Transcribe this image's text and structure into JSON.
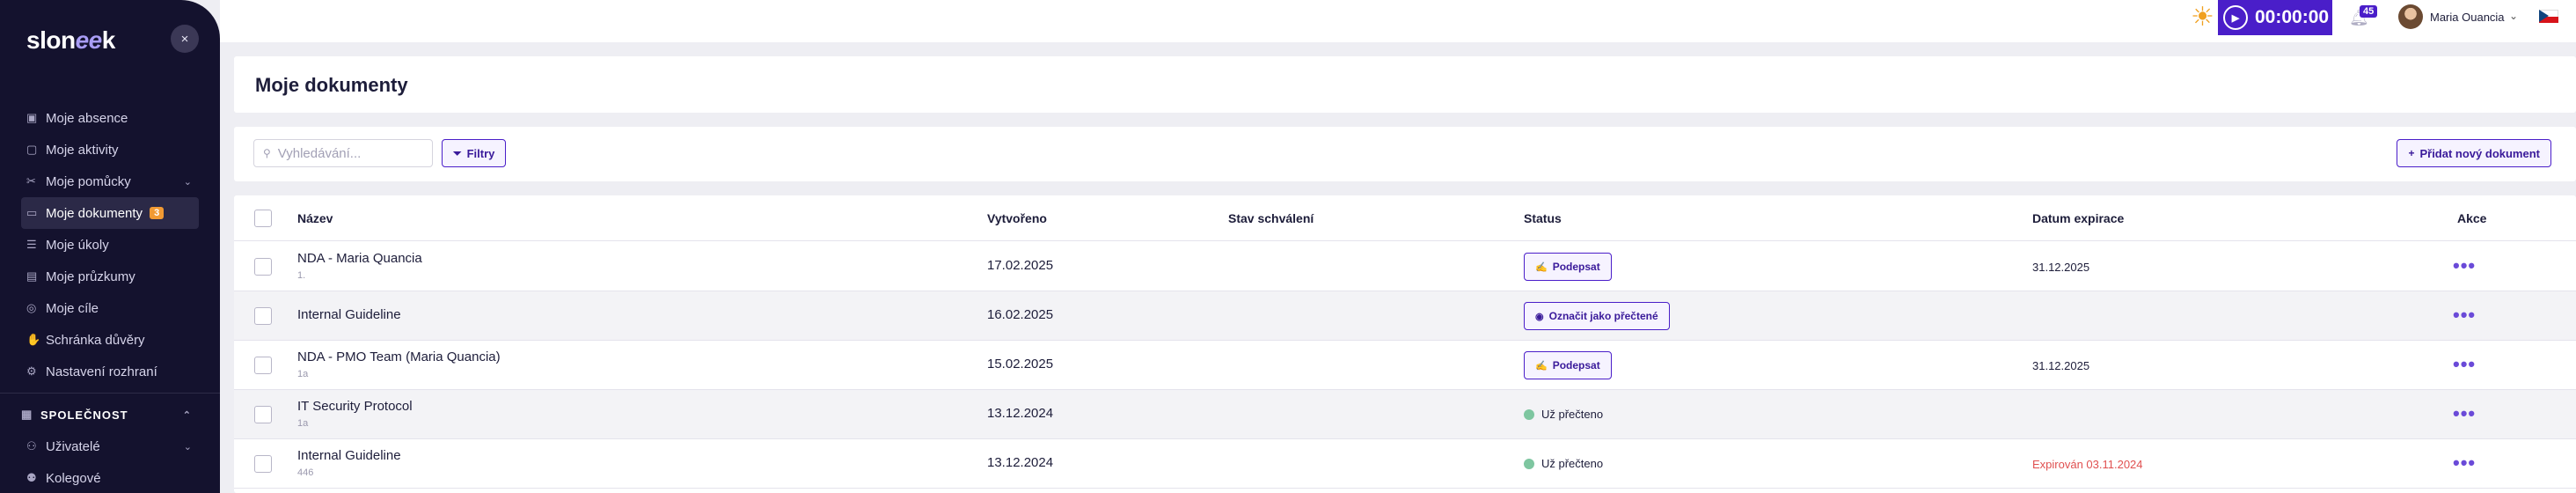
{
  "app": {
    "logo_text": "slon",
    "logo_accent": "ee",
    "logo_tail": "k",
    "close_symbol": "×"
  },
  "sidebar": {
    "items": [
      {
        "label": "Moje absence",
        "icon": "calendar-icon",
        "glyph": "▣"
      },
      {
        "label": "Moje aktivity",
        "icon": "book-icon",
        "glyph": "▢"
      },
      {
        "label": "Moje pomůcky",
        "icon": "tools-icon",
        "glyph": "✂",
        "chevron": "⌄"
      },
      {
        "label": "Moje dokumenty",
        "icon": "folder-icon",
        "glyph": "▭",
        "badge": "3",
        "active": true
      },
      {
        "label": "Moje úkoly",
        "icon": "list-icon",
        "glyph": "☰"
      },
      {
        "label": "Moje průzkumy",
        "icon": "survey-icon",
        "glyph": "▤"
      },
      {
        "label": "Moje cíle",
        "icon": "target-icon",
        "glyph": "◎"
      },
      {
        "label": "Schránka důvěry",
        "icon": "hand-icon",
        "glyph": "✋"
      },
      {
        "label": "Nastavení rozhraní",
        "icon": "gear-icon",
        "glyph": "⚙"
      }
    ],
    "section": {
      "label": "SPOLEČNOST",
      "icon": "building-icon",
      "glyph": "▦",
      "chevron": "⌃"
    },
    "section_items": [
      {
        "label": "Uživatelé",
        "icon": "users-icon",
        "glyph": "⚇",
        "chevron": "⌄"
      },
      {
        "label": "Kolegové",
        "icon": "colleagues-icon",
        "glyph": "⚉"
      }
    ]
  },
  "topbar": {
    "timer": "00:00:00",
    "notification_count": "45",
    "user_name": "Maria Ouancia",
    "language_flag": "czech-flag"
  },
  "page": {
    "title": "Moje dokumenty"
  },
  "filters": {
    "search_placeholder": "Vyhledávání...",
    "filter_label": "Filtry",
    "add_label": "Přidat nový dokument"
  },
  "table": {
    "headers": {
      "name": "Název",
      "created": "Vytvořeno",
      "approval": "Stav schválení",
      "status": "Status",
      "expiry": "Datum expirace",
      "actions": "Akce"
    },
    "rows": [
      {
        "name": "NDA - Maria Quancia",
        "sub": "1.",
        "created": "17.02.2025",
        "status_type": "button",
        "status": "Podepsat",
        "status_icon": "signature-icon",
        "expiry": "31.12.2025",
        "expired": false
      },
      {
        "name": "Internal Guideline",
        "sub": "",
        "created": "16.02.2025",
        "status_type": "button",
        "status": "Označit jako přečtené",
        "status_icon": "eye-icon",
        "expiry": "",
        "expired": false
      },
      {
        "name": "NDA - PMO Team (Maria Quancia)",
        "sub": "1a",
        "created": "15.02.2025",
        "status_type": "button",
        "status": "Podepsat",
        "status_icon": "signature-icon",
        "expiry": "31.12.2025",
        "expired": false
      },
      {
        "name": "IT Security Protocol",
        "sub": "1a",
        "created": "13.12.2024",
        "status_type": "read",
        "status": "Už přečteno",
        "status_icon": "",
        "expiry": "",
        "expired": false
      },
      {
        "name": "Internal Guideline",
        "sub": "446",
        "created": "13.12.2024",
        "status_type": "read",
        "status": "Už přečteno",
        "status_icon": "",
        "expiry": "Expirován 03.11.2024",
        "expired": true
      }
    ]
  },
  "colors": {
    "sidebar_bg": "#14122e",
    "accent": "#4a1ec9",
    "badge": "#f19a33",
    "read_dot": "#7ec6a0",
    "expired": "#e05050"
  }
}
